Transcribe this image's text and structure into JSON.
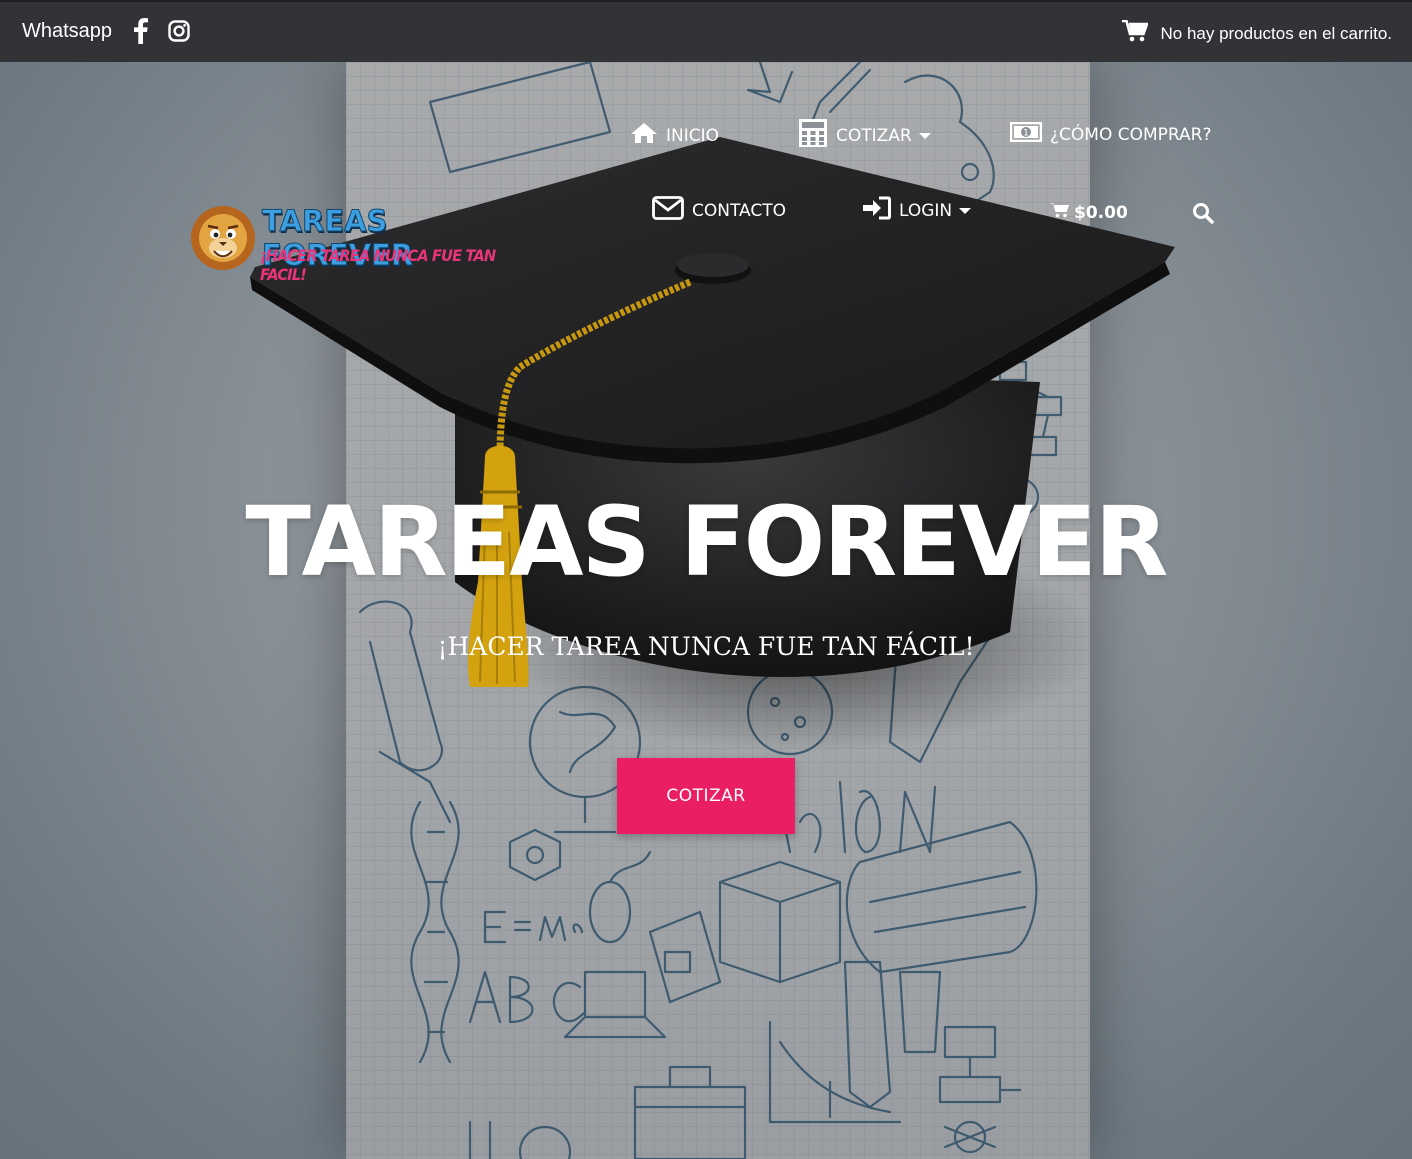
{
  "topbar": {
    "whatsapp_label": "Whatsapp",
    "cart_message": "No hay productos en el carrito."
  },
  "logo": {
    "title": "TAREAS FOREVER",
    "tagline": "¡HACER TAREA NUNCA FUE TAN FACIL!"
  },
  "nav": {
    "items": [
      {
        "label": "INICIO",
        "icon": "home-icon"
      },
      {
        "label": "COTIZAR",
        "icon": "calculator-icon",
        "dropdown": true
      },
      {
        "label": "¿CÓMO COMPRAR?",
        "icon": "money-icon"
      },
      {
        "label": "CONTACTO",
        "icon": "envelope-icon"
      },
      {
        "label": "LOGIN",
        "icon": "sign-in-icon",
        "dropdown": true
      },
      {
        "label": "$0.00",
        "icon": "cart-icon"
      }
    ],
    "search_icon": "search-icon"
  },
  "hero": {
    "title": "TAREAS FOREVER",
    "subtitle": "¡HACER TAREA NUNCA FUE TAN FÁCIL!",
    "cta_label": "COTIZAR"
  },
  "colors": {
    "topbar": "#323337",
    "accent": "#e91e63",
    "logo_blue": "#3b9fe0",
    "logo_pink": "#e8357a"
  }
}
